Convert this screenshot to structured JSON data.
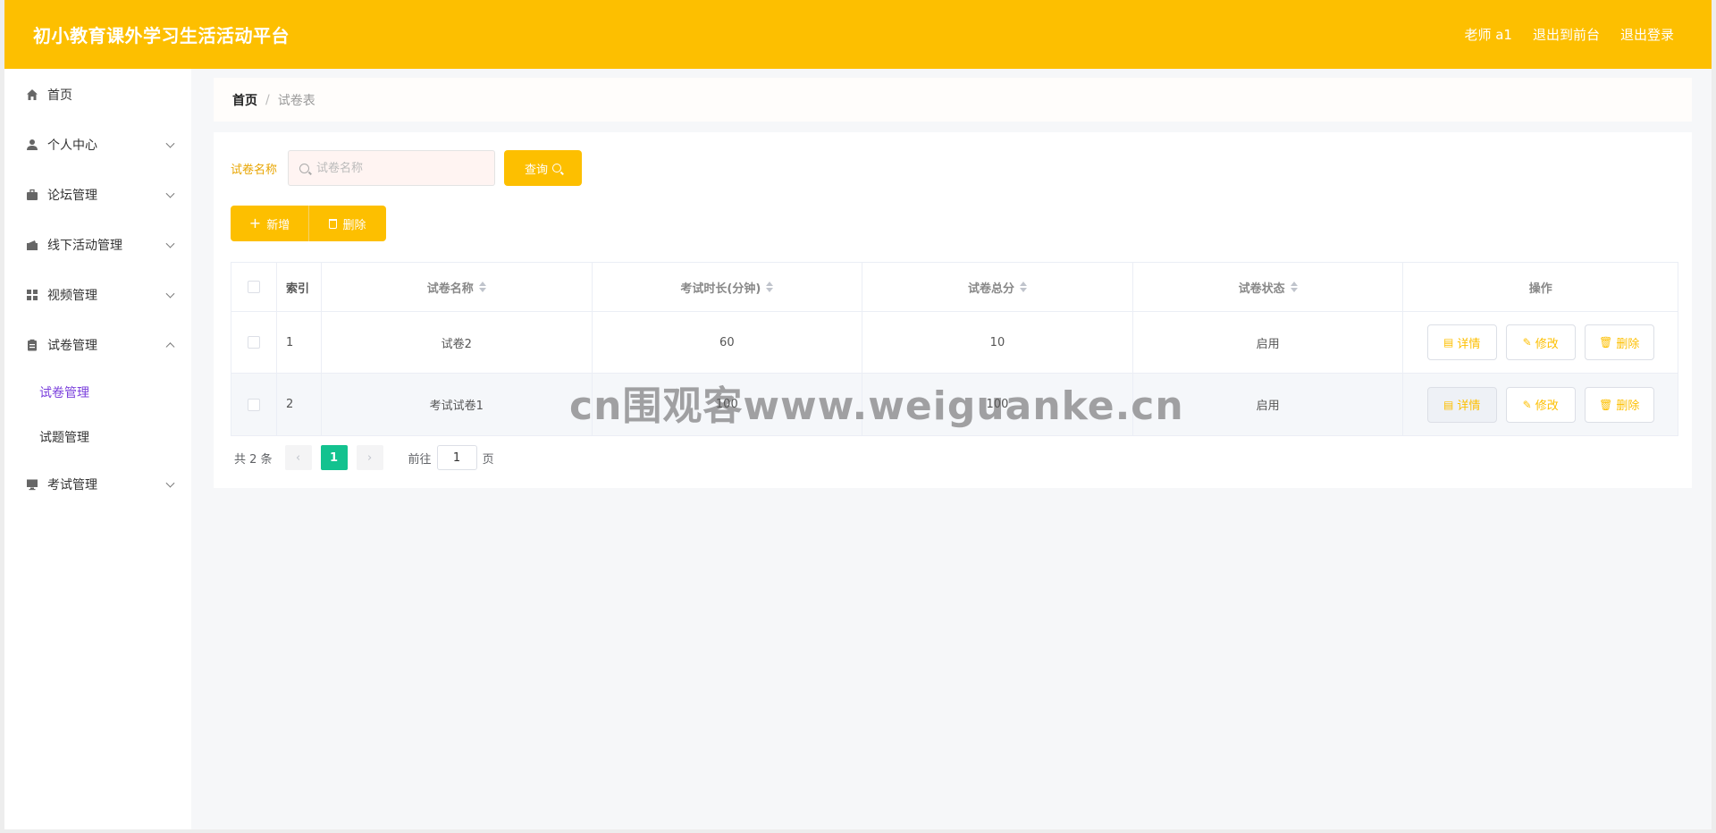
{
  "app": {
    "title": "初小教育课外学习生活活动平台"
  },
  "header": {
    "user": "老师 a1",
    "frontend": "退出到前台",
    "logout": "退出登录"
  },
  "sidebar": {
    "items": [
      {
        "label": "首页",
        "icon": "home-icon"
      },
      {
        "label": "个人中心",
        "icon": "user-icon"
      },
      {
        "label": "论坛管理",
        "icon": "briefcase-icon"
      },
      {
        "label": "线下活动管理",
        "icon": "wallet-icon"
      },
      {
        "label": "视频管理",
        "icon": "grid-icon"
      },
      {
        "label": "试卷管理",
        "icon": "clipboard-icon"
      },
      {
        "label": "考试管理",
        "icon": "monitor-icon"
      }
    ],
    "sub": {
      "exam_paper": "试卷管理",
      "question": "试题管理"
    }
  },
  "breadcrumb": {
    "home": "首页",
    "sep": "/",
    "current": "试卷表"
  },
  "search": {
    "label": "试卷名称",
    "placeholder": "试卷名称",
    "value": "",
    "button": "查询"
  },
  "actions": {
    "add": "新增",
    "delete": "删除"
  },
  "table": {
    "headers": {
      "index": "索引",
      "name": "试卷名称",
      "duration": "考试时长(分钟)",
      "score": "试卷总分",
      "status": "试卷状态",
      "ops": "操作"
    },
    "rows": [
      {
        "index": "1",
        "name": "试卷2",
        "duration": "60",
        "score": "10",
        "status": "启用"
      },
      {
        "index": "2",
        "name": "考试试卷1",
        "duration": "100",
        "score": "100",
        "status": "启用"
      }
    ],
    "op_labels": {
      "detail": "详情",
      "edit": "修改",
      "delete": "删除"
    }
  },
  "pagination": {
    "total": "共 2 条",
    "current": "1",
    "goto_label": "前往",
    "goto_value": "1",
    "page_unit": "页"
  },
  "watermark": "cn围观客www.weiguanke.cn",
  "colors": {
    "primary": "#fdbf00",
    "active_page": "#13c28f",
    "active_sub": "#7a3fdc"
  }
}
